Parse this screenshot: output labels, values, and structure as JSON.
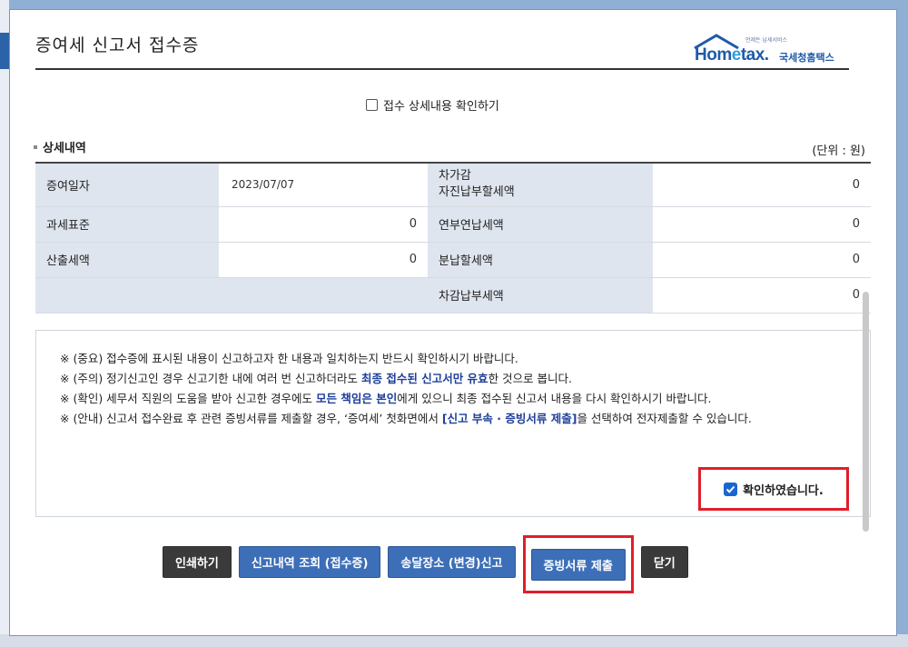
{
  "dialog": {
    "title": "증여세 신고서 접수증",
    "logo": {
      "word_prefix": "Hom",
      "word_e": "e",
      "word_suffix": "tax.",
      "korean": "국세청홈택스",
      "tagline": "언제든 납세서비스"
    }
  },
  "detail_toggle": {
    "label": "접수 상세내용 확인하기",
    "checked": false
  },
  "section": {
    "title": "상세내역",
    "unit": "(단위 : 원)"
  },
  "table": {
    "rows": [
      {
        "label1": "증여일자",
        "value1": "2023/07/07",
        "label2a": "차가감",
        "label2b": "자진납부할세액",
        "value2": "0"
      },
      {
        "label1": "과세표준",
        "value1": "0",
        "label2a": "연부연납세액",
        "label2b": "",
        "value2": "0"
      },
      {
        "label1": "산출세액",
        "value1": "0",
        "label2a": "분납할세액",
        "label2b": "",
        "value2": "0"
      },
      {
        "label1": "",
        "value1": "",
        "label2a": "차감납부세액",
        "label2b": "",
        "value2": "0"
      }
    ]
  },
  "notice": {
    "line1": "※ (중요) 접수증에 표시된 내용이 신고하고자 한 내용과 일치하는지 반드시 확인하시기 바랍니다.",
    "line2_pre": "※ (주의) 정기신고인 경우 신고기한 내에 여러 번 신고하더라도 ",
    "line2_bold": "최종 접수된 신고서만 유효",
    "line2_post": "한 것으로 봅니다.",
    "line3_pre": "※ (확인) 세무서 직원의 도움을 받아 신고한 경우에도 ",
    "line3_bold": "모든 책임은 본인",
    "line3_post": "에게 있으니 최종 접수된 신고서 내용을 다시 확인하시기 바랍니다.",
    "line4_pre": "※ (안내) 신고서 접수완료 후 관련 증빙서류를 제출할 경우, ‘증여세’ 첫화면에서 ",
    "line4_bold": "[신고 부속 · 증빙서류 제출]",
    "line4_post": "을 선택하여 전자제출할 수 있습니다."
  },
  "confirm": {
    "label": "확인하였습니다.",
    "checked": true
  },
  "buttons": {
    "print": "인쇄하기",
    "history": "신고내역 조회 (접수증)",
    "delivery": "송달장소 (변경)신고",
    "evidence": "증빙서류 제출",
    "close": "닫기"
  },
  "colors": {
    "accent_blue": "#3d6fb8",
    "dark_button": "#3a3a3a",
    "highlight_red": "#e01e2a",
    "label_bg": "#dfe5ee"
  }
}
